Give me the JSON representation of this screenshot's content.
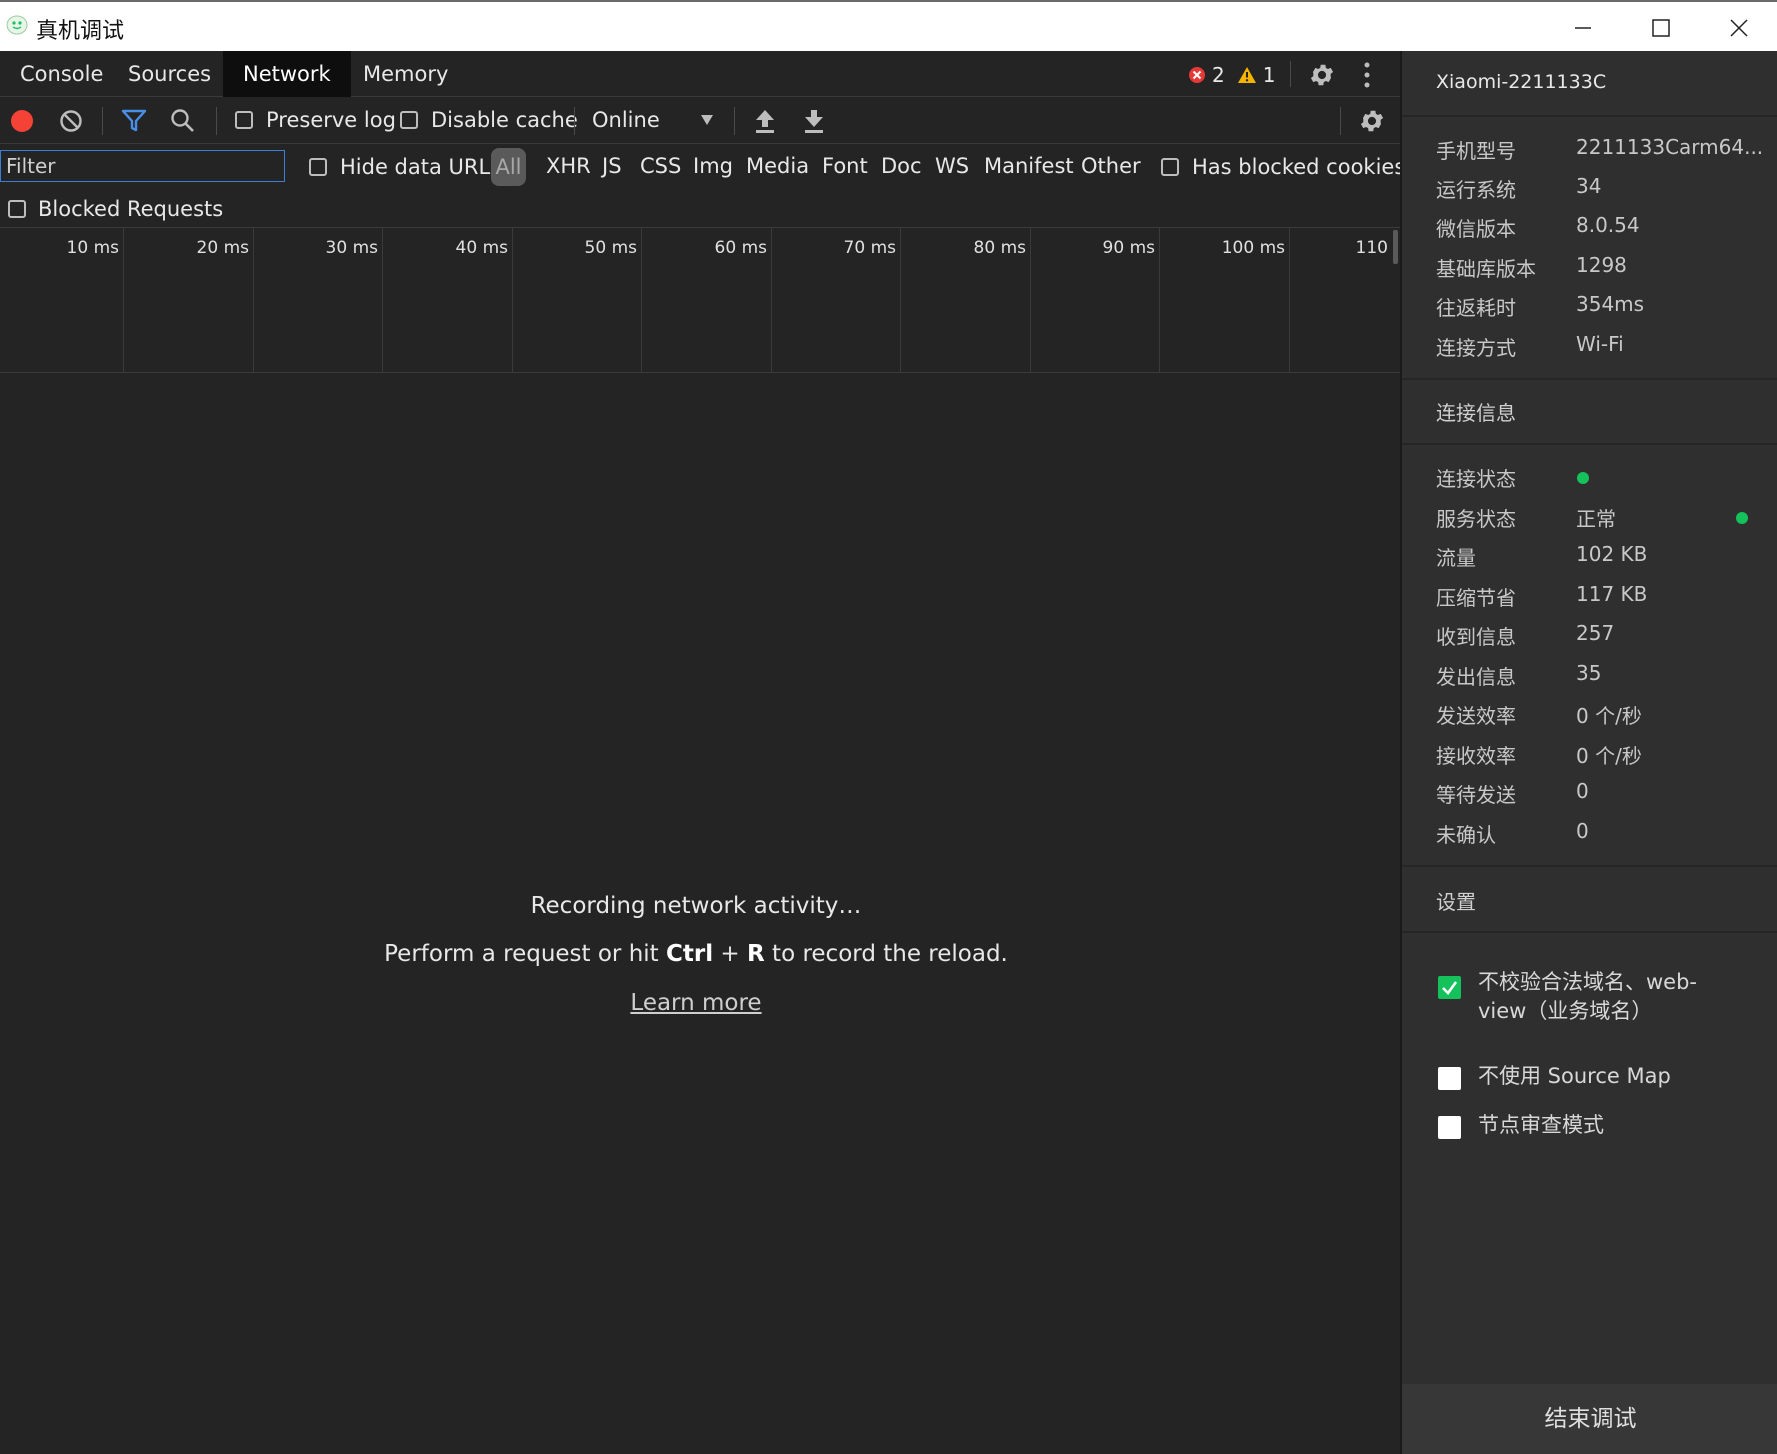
{
  "window": {
    "title": "真机调试",
    "colors": {
      "accent": "#14c15b",
      "link": "#3d7dd6",
      "error": "#e53935",
      "warning": "#f5b400"
    }
  },
  "tabs": [
    {
      "label": "Console"
    },
    {
      "label": "Sources"
    },
    {
      "label": "Network",
      "active": true
    },
    {
      "label": "Memory"
    }
  ],
  "issues": {
    "errors": "2",
    "warnings": "1"
  },
  "toolbar": {
    "preserve_log": "Preserve log",
    "disable_cache": "Disable cache",
    "throttling": "Online",
    "icons": [
      "record-icon",
      "clear-icon",
      "filter-icon",
      "search-icon",
      "chevron-down-icon",
      "upload-icon",
      "download-icon",
      "gear-icon"
    ]
  },
  "filterbar": {
    "placeholder": "Filter",
    "hide_data_urls": "Hide data URLs",
    "types": [
      "All",
      "XHR",
      "JS",
      "CSS",
      "Img",
      "Media",
      "Font",
      "Doc",
      "WS",
      "Manifest",
      "Other"
    ],
    "has_blocked_cookies": "Has blocked cookies",
    "blocked_requests": "Blocked Requests"
  },
  "timeline": {
    "ticks": [
      "10 ms",
      "20 ms",
      "30 ms",
      "40 ms",
      "50 ms",
      "60 ms",
      "70 ms",
      "80 ms",
      "90 ms",
      "100 ms",
      "110"
    ]
  },
  "empty": {
    "title": "Recording network activity…",
    "hint_pre": "Perform a request or hit ",
    "hint_key1": "Ctrl",
    "hint_plus": " + ",
    "hint_key2": "R",
    "hint_post": " to record the reload.",
    "learn_more": "Learn more"
  },
  "panel": {
    "device": "Xiaomi-2211133C",
    "info": [
      {
        "key": "手机型号",
        "value": "2211133Carm64..."
      },
      {
        "key": "运行系统",
        "value": "34"
      },
      {
        "key": "微信版本",
        "value": "8.0.54"
      },
      {
        "key": "基础库版本",
        "value": "1298"
      },
      {
        "key": "往返耗时",
        "value": "354ms"
      },
      {
        "key": "连接方式",
        "value": "Wi-Fi"
      }
    ],
    "connection_title": "连接信息",
    "connection": [
      {
        "key": "连接状态",
        "value": ""
      },
      {
        "key": "服务状态",
        "value": "正常"
      },
      {
        "key": "流量",
        "value": "102 KB"
      },
      {
        "key": "压缩节省",
        "value": "117 KB"
      },
      {
        "key": "收到信息",
        "value": "257"
      },
      {
        "key": "发出信息",
        "value": "35"
      },
      {
        "key": "发送效率",
        "value": "0 个/秒"
      },
      {
        "key": "接收效率",
        "value": "0 个/秒"
      },
      {
        "key": "等待发送",
        "value": "0"
      },
      {
        "key": "未确认",
        "value": "0"
      }
    ],
    "settings_title": "设置",
    "settings": [
      {
        "label": "不校验合法域名、web-view（业务域名）",
        "checked": true
      },
      {
        "label": "不使用 Source Map",
        "checked": false
      },
      {
        "label": "节点审查模式",
        "checked": false
      }
    ],
    "end_button": "结束调试"
  }
}
